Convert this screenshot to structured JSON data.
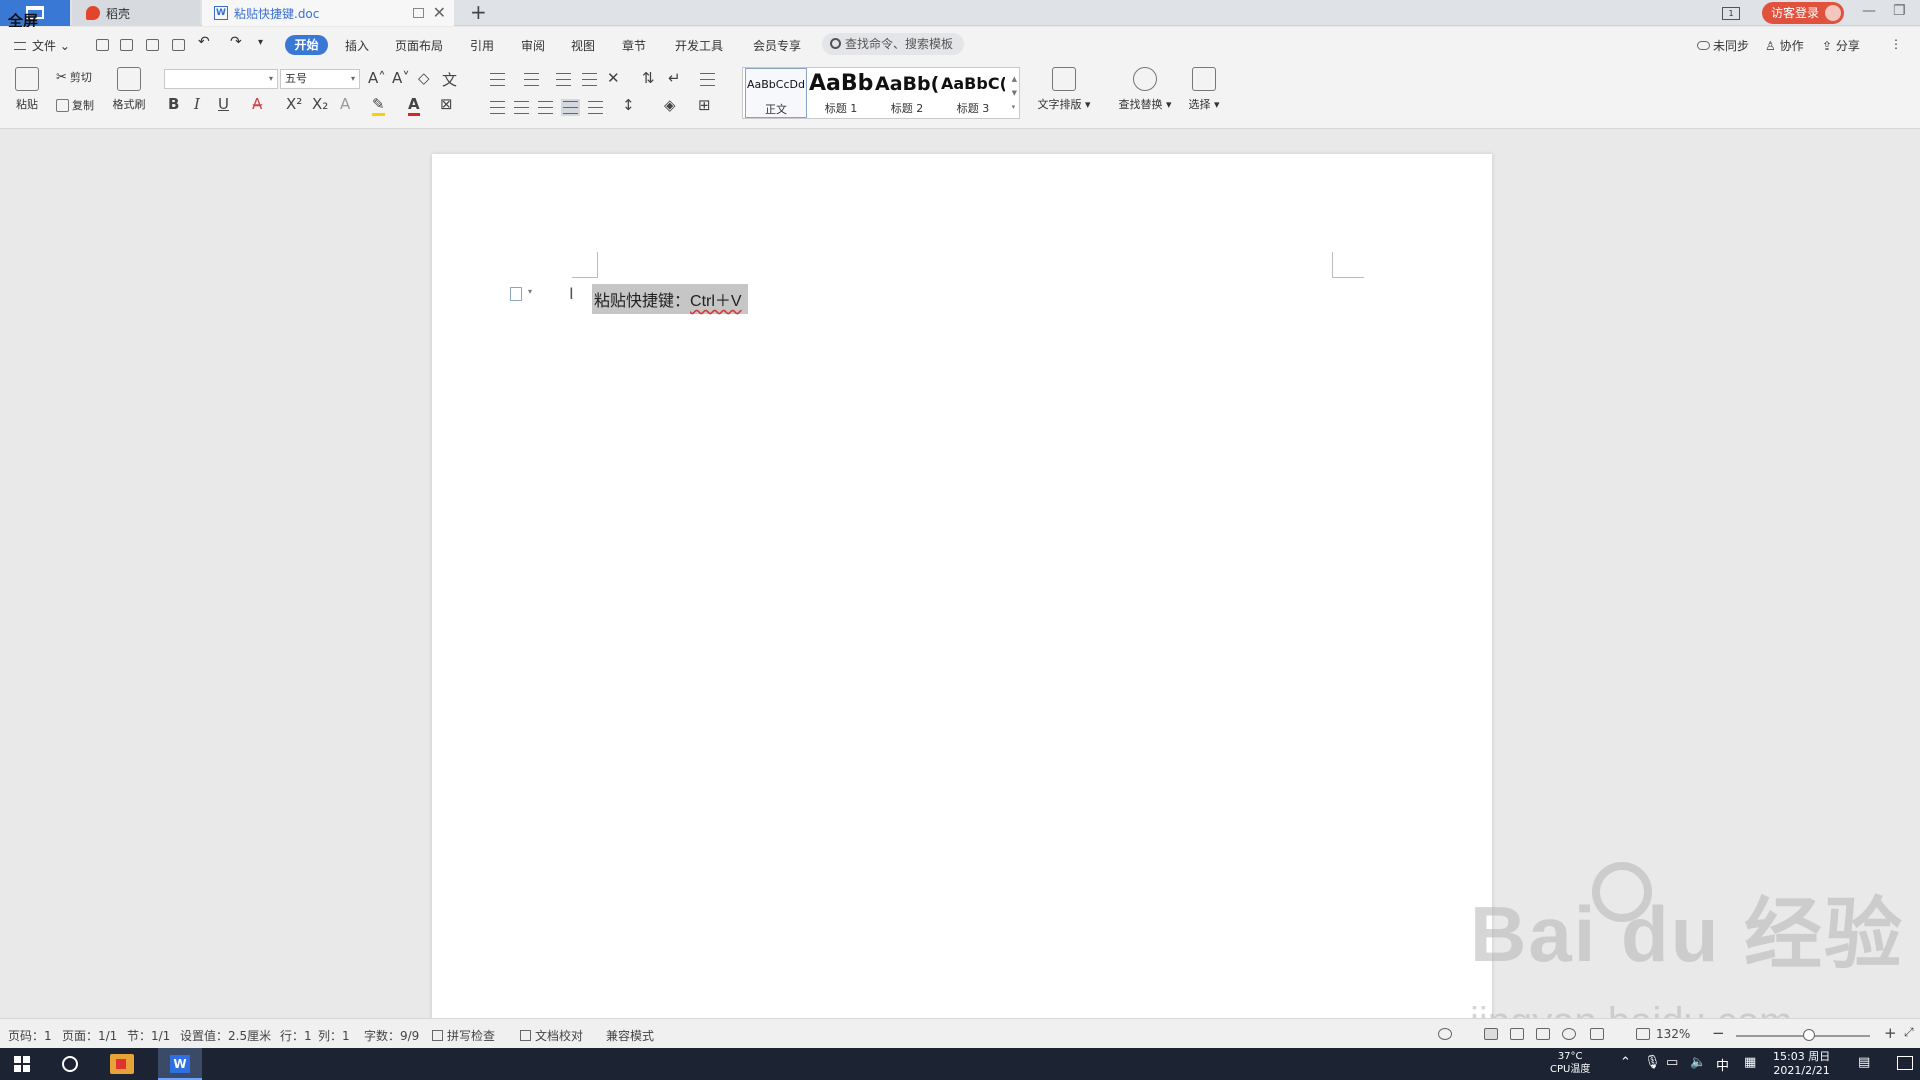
{
  "titlebar": {
    "home_label": "全屏",
    "tabs": [
      {
        "label": "稻壳"
      },
      {
        "label": "粘贴快捷键.doc"
      }
    ],
    "new_tab": "+",
    "login_label": "访客登录",
    "panel_badge": "1"
  },
  "menu": {
    "file": "文件",
    "items": [
      "开始",
      "插入",
      "页面布局",
      "引用",
      "审阅",
      "视图",
      "章节",
      "开发工具",
      "会员专享"
    ],
    "active": "开始",
    "search_placeholder": "查找命令、搜索模板",
    "right": {
      "sync": "未同步",
      "collab": "协作",
      "share": "分享"
    }
  },
  "ribbon": {
    "paste": "粘贴",
    "cut": "剪切",
    "copy": "复制",
    "format_painter": "格式刷",
    "font_name": "",
    "font_size": "五号",
    "bold": "B",
    "italic": "I",
    "underline": "U",
    "font_color_glyph": "A",
    "styles": [
      {
        "preview": "AaBbCcDd",
        "label": "正文"
      },
      {
        "preview": "AaBb",
        "label": "标题 1"
      },
      {
        "preview": "AaBb(",
        "label": "标题 2"
      },
      {
        "preview": "AaBbC(",
        "label": "标题 3"
      }
    ],
    "text_layout": "文字排版",
    "find_replace": "查找替换",
    "select": "选择"
  },
  "document": {
    "text_cjk": "粘贴快捷键：",
    "text_latin": "Ctrl＋V"
  },
  "watermark": {
    "main": "Bai  du 经验",
    "sub": "jingyan.baidu.com"
  },
  "statusbar": {
    "page_num": "页码：1",
    "pages": "页面：1/1",
    "section": "节：1/1",
    "position": "设置值：2.5厘米",
    "line": "行：1",
    "col": "列：1",
    "words": "字数：9/9",
    "spell": "拼写检查",
    "proof": "文档校对",
    "compat": "兼容模式",
    "zoom": "132%"
  },
  "taskbar": {
    "temp": "37°C",
    "cpu": "CPU温度",
    "ime": "中",
    "time": "15:03 周日",
    "date": "2021/2/21"
  }
}
